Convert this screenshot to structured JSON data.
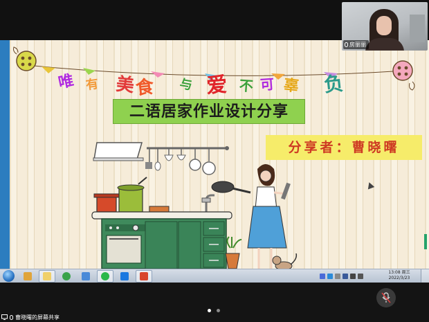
{
  "meeting": {
    "participant_name": "房丽丽",
    "sharing_label": "曹晓曙的屏幕共享",
    "page_dots": 2,
    "active_dot": 0
  },
  "slide": {
    "title_chars": [
      "唯",
      "有",
      "美",
      "食",
      "与",
      "爱",
      "不",
      "可",
      "辜",
      "负"
    ],
    "subtitle": "二语居家作业设计分享",
    "speaker_text": "分享者：曹晓曙"
  },
  "taskbar": {
    "clock_time": "13:08 周三",
    "clock_date": "2022/3/23"
  },
  "colors": {
    "subtitle_bg": "#8fd14f",
    "speaker_bg": "#f6ec6a",
    "speaker_text": "#ce3a23",
    "accent_green": "#24a36a"
  },
  "icons": {
    "mic": "microphone-icon",
    "start": "windows-start-icon",
    "screen_share": "screen-share-icon"
  }
}
